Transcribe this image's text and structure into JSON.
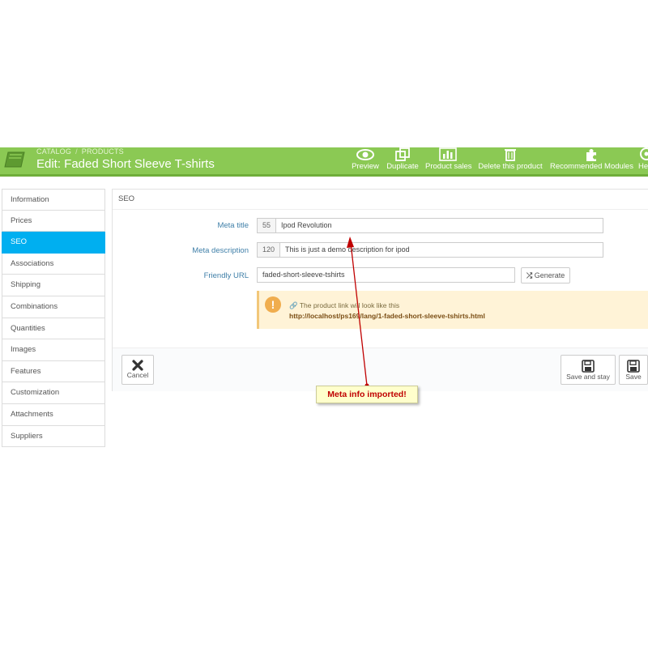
{
  "header": {
    "breadcrumb": [
      "CATALOG",
      "PRODUCTS"
    ],
    "breadcrumb_sep": "/",
    "title": "Edit: Faded Short Sleeve T-shirts",
    "toolbar": [
      {
        "label": "Preview",
        "icon": "eye-icon"
      },
      {
        "label": "Duplicate",
        "icon": "duplicate-icon"
      },
      {
        "label": "Product sales",
        "icon": "bar-chart-icon"
      },
      {
        "label": "Delete this product",
        "icon": "trash-icon"
      },
      {
        "label": "Recommended Modules",
        "icon": "puzzle-icon"
      },
      {
        "label": "He",
        "icon": "help-icon"
      }
    ],
    "color": "#8bc954"
  },
  "sidebar": {
    "items": [
      {
        "label": "Information"
      },
      {
        "label": "Prices"
      },
      {
        "label": "SEO",
        "active": true
      },
      {
        "label": "Associations"
      },
      {
        "label": "Shipping"
      },
      {
        "label": "Combinations"
      },
      {
        "label": "Quantities"
      },
      {
        "label": "Images"
      },
      {
        "label": "Features"
      },
      {
        "label": "Customization"
      },
      {
        "label": "Attachments"
      },
      {
        "label": "Suppliers"
      }
    ],
    "active_color": "#00aff0"
  },
  "panel": {
    "heading": "SEO",
    "meta_title": {
      "label": "Meta title",
      "count": "55",
      "value": "Ipod Revolution"
    },
    "meta_description": {
      "label": "Meta description",
      "count": "120",
      "value": "This is just a demo description for ipod"
    },
    "friendly_url": {
      "label": "Friendly URL",
      "value": "faded-short-sleeve-tshirts",
      "generate_label": "Generate"
    },
    "alert": {
      "text": "The product link will look like this",
      "url": "http://localhost/ps169/lang/1-faded-short-sleeve-tshirts.html"
    },
    "footer": {
      "cancel_label": "Cancel",
      "save_stay_label": "Save and stay",
      "save_label": "Save"
    }
  },
  "annotation": {
    "text": "Meta info imported!",
    "color": "#c00000"
  }
}
